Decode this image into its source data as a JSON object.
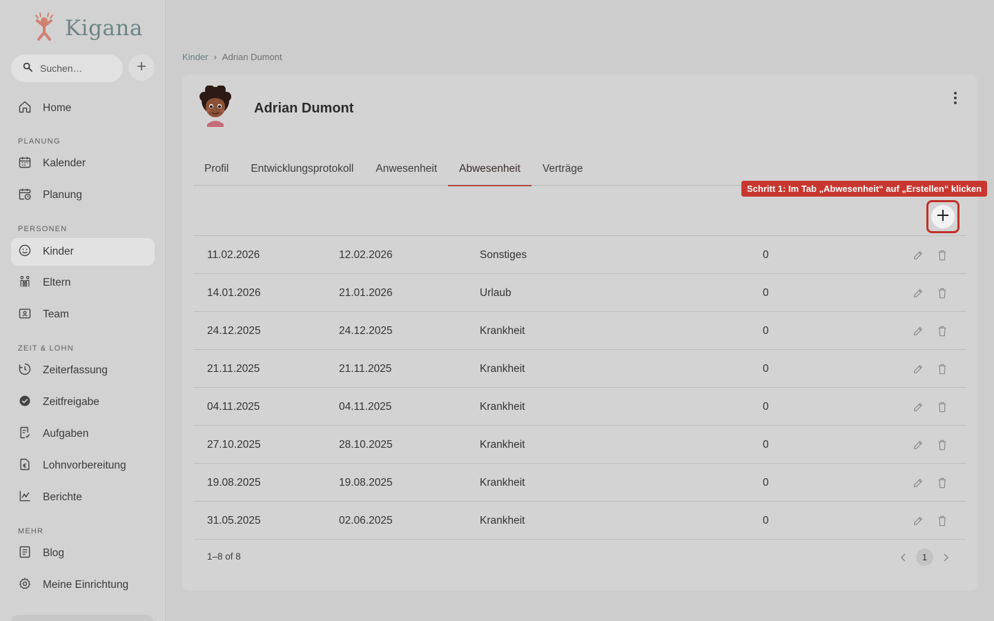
{
  "brand": {
    "name": "Kigana",
    "logo_color": "#d08070",
    "text_color": "#6e8486"
  },
  "search": {
    "placeholder": "Suchen…"
  },
  "sidebar": {
    "home": {
      "label": "Home"
    },
    "sections": [
      {
        "label": "PLANUNG",
        "items": [
          {
            "label": "Kalender",
            "icon": "calendar-icon"
          },
          {
            "label": "Planung",
            "icon": "calendar-clock-icon"
          }
        ]
      },
      {
        "label": "PERSONEN",
        "items": [
          {
            "label": "Kinder",
            "icon": "smiley-face-icon",
            "active": true
          },
          {
            "label": "Eltern",
            "icon": "family-icon"
          },
          {
            "label": "Team",
            "icon": "badge-icon"
          }
        ]
      },
      {
        "label": "ZEIT & LOHN",
        "items": [
          {
            "label": "Zeiterfassung",
            "icon": "clock-history-icon"
          },
          {
            "label": "Zeitfreigabe",
            "icon": "check-circle-icon"
          },
          {
            "label": "Aufgaben",
            "icon": "task-icon"
          },
          {
            "label": "Lohnvorbereitung",
            "icon": "euro-document-icon"
          },
          {
            "label": "Berichte",
            "icon": "chart-icon"
          }
        ]
      },
      {
        "label": "MEHR",
        "items": [
          {
            "label": "Blog",
            "icon": "article-icon"
          },
          {
            "label": "Meine Einrichtung",
            "icon": "gear-icon"
          }
        ]
      }
    ]
  },
  "breadcrumb": {
    "parent": "Kinder",
    "separator": "›",
    "current": "Adrian Dumont"
  },
  "child": {
    "name": "Adrian Dumont"
  },
  "tabs": [
    {
      "label": "Profil"
    },
    {
      "label": "Entwicklungsprotokoll"
    },
    {
      "label": "Anwesenheit"
    },
    {
      "label": "Abwesenheit",
      "active": true
    },
    {
      "label": "Verträge"
    }
  ],
  "hint": {
    "text": "Schritt 1: Im Tab „Abwesenheit“ auf „Erstellen“ klicken",
    "color": "#c8372f"
  },
  "absences": [
    {
      "from": "11.02.2026",
      "to": "12.02.2026",
      "type": "Sonstiges",
      "days": "0"
    },
    {
      "from": "14.01.2026",
      "to": "21.01.2026",
      "type": "Urlaub",
      "days": "0"
    },
    {
      "from": "24.12.2025",
      "to": "24.12.2025",
      "type": "Krankheit",
      "days": "0"
    },
    {
      "from": "21.11.2025",
      "to": "21.11.2025",
      "type": "Krankheit",
      "days": "0"
    },
    {
      "from": "04.11.2025",
      "to": "04.11.2025",
      "type": "Krankheit",
      "days": "0"
    },
    {
      "from": "27.10.2025",
      "to": "28.10.2025",
      "type": "Krankheit",
      "days": "0"
    },
    {
      "from": "19.08.2025",
      "to": "19.08.2025",
      "type": "Krankheit",
      "days": "0"
    },
    {
      "from": "31.05.2025",
      "to": "02.06.2025",
      "type": "Krankheit",
      "days": "0"
    }
  ],
  "pagination": {
    "summary": "1–8 of 8",
    "current_page": "1"
  }
}
